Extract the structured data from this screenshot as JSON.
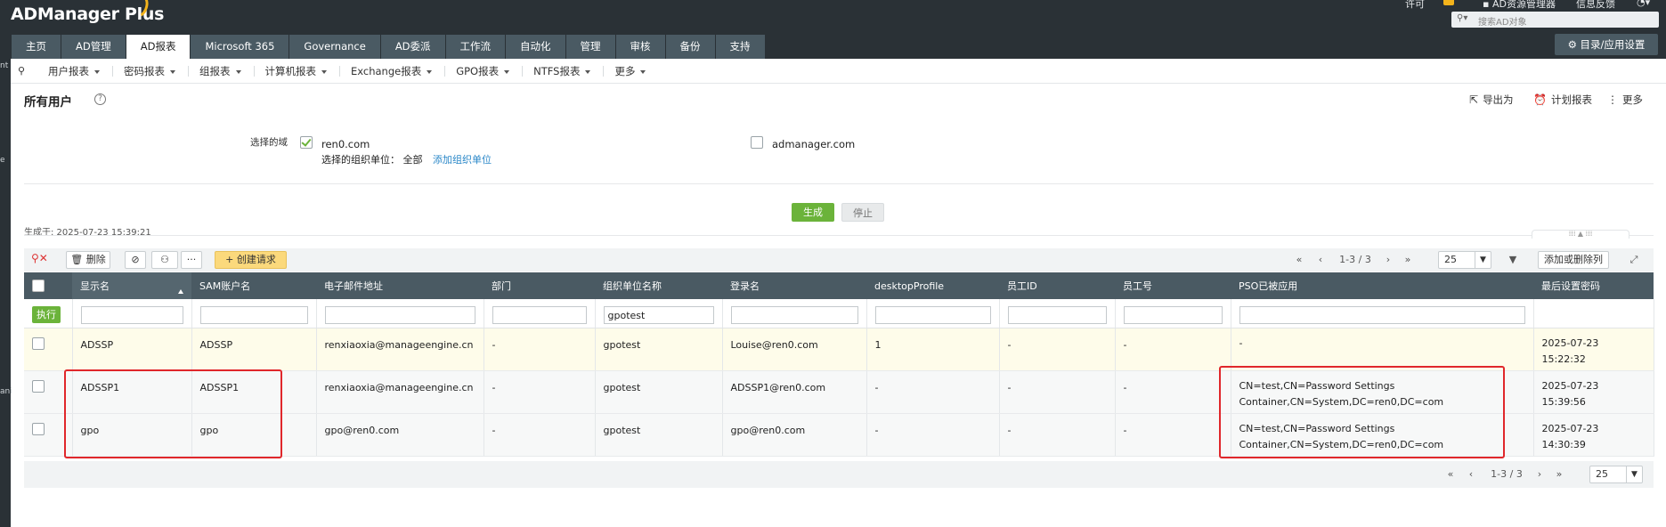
{
  "app": {
    "name": "ADManager Plus",
    "top_links": [
      "许可",
      "AD资源管理器",
      "信息反馈"
    ],
    "search_placeholder": "搜索AD对象"
  },
  "tabs": [
    {
      "label": "主页",
      "active": false
    },
    {
      "label": "AD管理",
      "active": false
    },
    {
      "label": "AD报表",
      "active": true
    },
    {
      "label": "Microsoft 365",
      "active": false
    },
    {
      "label": "Governance",
      "active": false
    },
    {
      "label": "AD委派",
      "active": false
    },
    {
      "label": "工作流",
      "active": false
    },
    {
      "label": "自动化",
      "active": false
    },
    {
      "label": "管理",
      "active": false
    },
    {
      "label": "审核",
      "active": false
    },
    {
      "label": "备份",
      "active": false
    },
    {
      "label": "支持",
      "active": false
    }
  ],
  "settings_button": "目录/应用设置",
  "submenu": [
    "用户报表",
    "密码报表",
    "组报表",
    "计算机报表",
    "Exchange报表",
    "GPO报表",
    "NTFS报表",
    "更多"
  ],
  "page": {
    "title": "所有用户",
    "actions": {
      "export": "导出为",
      "schedule": "计划报表",
      "more": "更多"
    }
  },
  "domain_select": {
    "label": "选择的域",
    "domains": [
      {
        "name": "ren0.com",
        "checked": true
      },
      {
        "name": "admanager.com",
        "checked": false
      }
    ],
    "ou_label": "选择的组织单位：",
    "ou_value": "全部",
    "add_ou_link": "添加组织单位"
  },
  "buttons": {
    "generate": "生成",
    "stop": "停止"
  },
  "generated_at": "生成于: 2025-07-23 15:39:21",
  "toolbar": {
    "delete": "删除",
    "create_request": "创建请求",
    "more": "···",
    "page_range": "1-3 / 3",
    "page_size": "25",
    "add_remove_columns": "添加或删除列"
  },
  "table": {
    "columns": [
      "显示名",
      "SAM账户名",
      "电子邮件地址",
      "部门",
      "组织单位名称",
      "登录名",
      "desktopProfile",
      "员工ID",
      "员工号",
      "PSO已被应用",
      "最后设置密码"
    ],
    "sorted_column": "显示名",
    "exec_label": "执行",
    "filters": {
      "ou": "gpotest"
    },
    "rows": [
      {
        "display": "ADSSP",
        "sam": "ADSSP",
        "email": "renxiaoxia@manageengine.cn",
        "dept": "-",
        "ou": "gpotest",
        "logon": "Louise@ren0.com",
        "desktop": "1",
        "empid": "-",
        "empno": "-",
        "pso_line1": "-",
        "pso_line2": "",
        "pwd_date": "2025-07-23",
        "pwd_time": "15:22:32"
      },
      {
        "display": "ADSSP1",
        "sam": "ADSSP1",
        "email": "renxiaoxia@manageengine.cn",
        "dept": "-",
        "ou": "gpotest",
        "logon": "ADSSP1@ren0.com",
        "desktop": "-",
        "empid": "-",
        "empno": "-",
        "pso_line1": "CN=test,CN=Password Settings",
        "pso_line2": "Container,CN=System,DC=ren0,DC=com",
        "pwd_date": "2025-07-23",
        "pwd_time": "15:39:56"
      },
      {
        "display": "gpo",
        "sam": "gpo",
        "email": "gpo@ren0.com",
        "dept": "-",
        "ou": "gpotest",
        "logon": "gpo@ren0.com",
        "desktop": "-",
        "empid": "-",
        "empno": "-",
        "pso_line1": "CN=test,CN=Password Settings",
        "pso_line2": "Container,CN=System,DC=ren0,DC=com",
        "pwd_date": "2025-07-23",
        "pwd_time": "14:30:39"
      }
    ]
  },
  "colors": {
    "header_bg": "#2a3136",
    "tab_bg": "#4a5a63",
    "accent_green": "#6bb33a",
    "highlight_red": "#e0272b",
    "create_btn": "#fbd97c"
  }
}
